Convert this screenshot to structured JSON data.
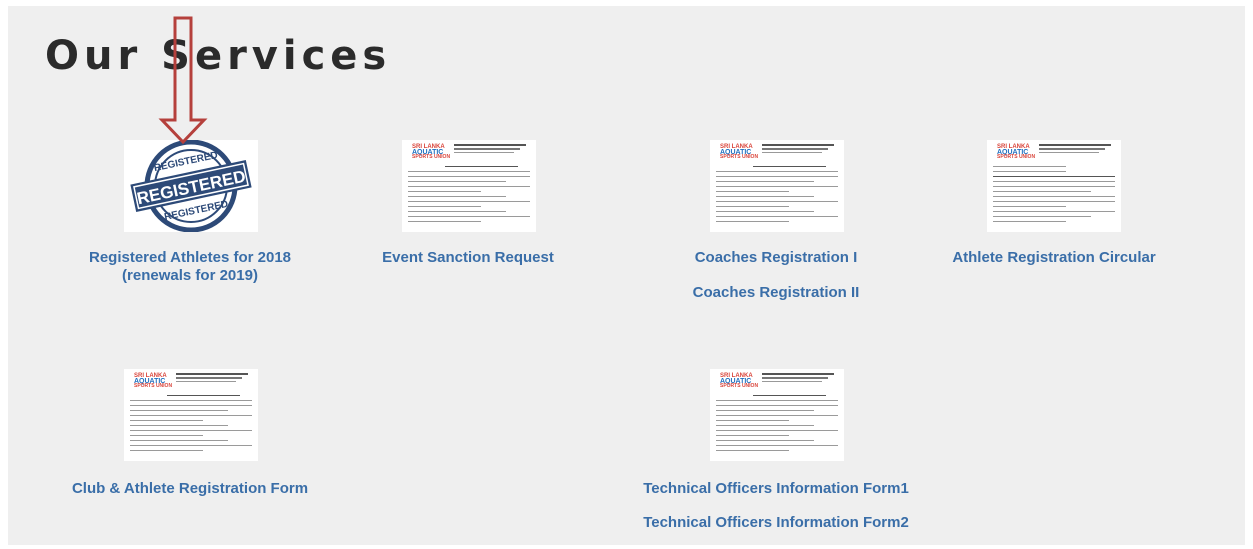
{
  "page": {
    "title": "Our Services"
  },
  "services": {
    "registered_athletes": "Registered Athletes for 2018\n(renewals for 2019)",
    "registered_athletes_line1": "Registered Athletes for 2018",
    "registered_athletes_line2": "(renewals for 2019)",
    "event_sanction": "Event Sanction Request",
    "coaches_1": "Coaches Registration I",
    "coaches_2": "Coaches Registration II",
    "athlete_circular": "Athlete Registration Circular",
    "club_athlete_form": "Club & Athlete Registration Form",
    "tech_officers_1": "Technical Officers Information Form1",
    "tech_officers_2": "Technical Officers Information Form2"
  },
  "stamp": {
    "top_text": "REGISTERED",
    "center_text": "REGISTERED",
    "bottom_text": "REGISTERED"
  },
  "colors": {
    "link": "#3a6ea8",
    "arrow": "#b5403c",
    "panel": "#efefef",
    "stamp_blue": "#2d4a78"
  },
  "icons": {
    "annotation": "red-down-arrow-icon",
    "thumbnail": "document-thumbnail-icon"
  }
}
